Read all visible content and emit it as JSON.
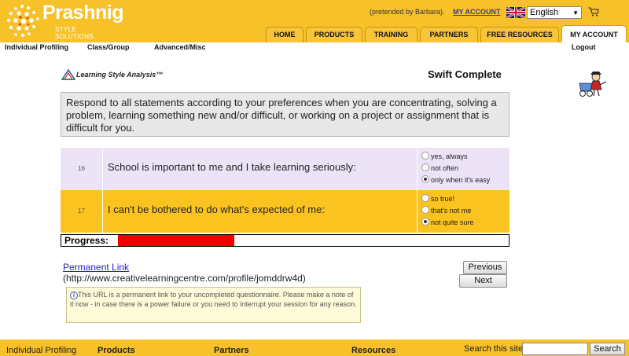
{
  "header": {
    "brand_name": "Prashnig",
    "brand_sub": "STYLE SOLUTIONS",
    "pretended_by": "(pretended by Barbara).",
    "my_account_link": "MY ACCOUNT",
    "language": "English",
    "tabs": [
      {
        "label": "HOME"
      },
      {
        "label": "PRODUCTS"
      },
      {
        "label": "TRAINING"
      },
      {
        "label": "PARTNERS"
      },
      {
        "label": "FREE RESOURCES"
      },
      {
        "label": "MY ACCOUNT",
        "active": true
      }
    ]
  },
  "subnav": {
    "items": [
      "Individual Profiling",
      "Class/Group",
      "Advanced/Misc"
    ],
    "logout": "Logout"
  },
  "content": {
    "lsa_logo_text": "Learning Style Analysis™",
    "title": "Swift Complete",
    "instructions": "Respond to all statements according to your preferences when you are concentrating, solving a problem, learning something new and/or difficult, or working on a project or assignment that is difficult for you.",
    "questions": [
      {
        "number": "16",
        "text": "School is important to me and I take learning seriously:",
        "options": [
          "yes, always",
          "not often",
          "only when it's easy"
        ],
        "selected": 2
      },
      {
        "number": "17",
        "text": "I can't be bothered to do what's expected of me:",
        "options": [
          "so true!",
          "that's not me",
          "not quite sure"
        ],
        "selected": 2
      }
    ],
    "progress_label": "Progress:",
    "progress_fraction": 0.3,
    "permanent_link_label": "Permanent Link",
    "permanent_link_url": "(http://www.creativelearningcentre.com/profile/jomddrw4d)",
    "previous_button": "Previous",
    "next_button": "Next",
    "info_text": "This URL is a permanent link to your uncompleted questionnaire. Please make a note of it now - in case there is a power failure or you need to interrupt your session for any reason."
  },
  "footer": {
    "items": [
      "Individual Profiling",
      "Products",
      "Partners",
      "Resources"
    ],
    "search_label": "Search this site:",
    "search_value": "",
    "search_button": "Search"
  },
  "colors": {
    "brand_yellow": "#f7c12a",
    "purple_row": "#ece3f7",
    "yellow_row": "#fbc31f",
    "progress_red": "#ee0000"
  }
}
